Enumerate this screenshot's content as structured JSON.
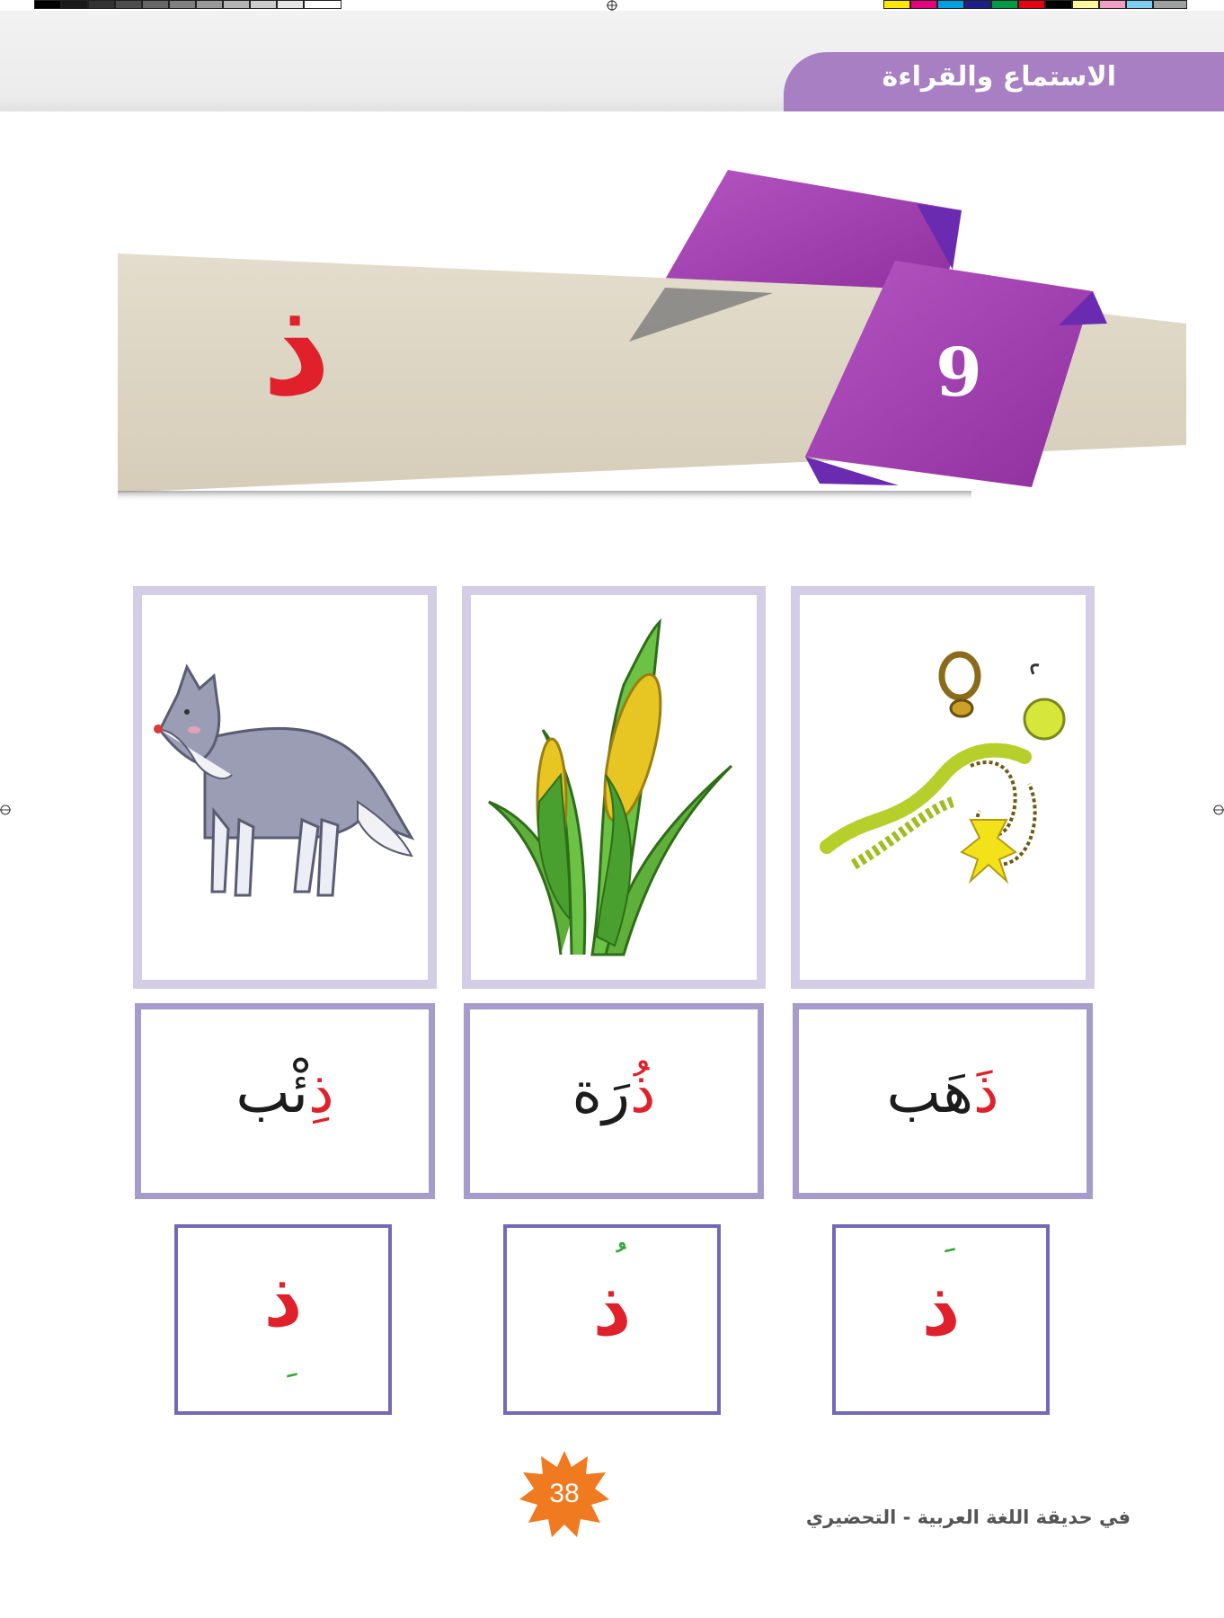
{
  "header": {
    "title": "الاستماع والقراءة"
  },
  "banner": {
    "letter": "ذ",
    "lesson_number": "9"
  },
  "cards": [
    {
      "image": "gold-jewelry",
      "word_first": "ذَ",
      "word_rest": "هَب",
      "letter": "ذ",
      "vowel_mark": "َ",
      "vowel_position": "above"
    },
    {
      "image": "corn",
      "word_first": "ذُ",
      "word_rest": "رَة",
      "letter": "ذ",
      "vowel_mark": "ُ",
      "vowel_position": "above"
    },
    {
      "image": "wolf",
      "word_first": "ذِ",
      "word_rest": "ئْب",
      "letter": "ذ",
      "vowel_mark": "ِ",
      "vowel_position": "below"
    }
  ],
  "colors": {
    "accent_purple": "#a77fc2",
    "ribbon_purple": "#9b3aa8",
    "letter_red": "#e0202a",
    "vowel_green": "#35a83a",
    "banner_beige": "#ddd5c4",
    "page_badge_orange": "#f07a1f"
  },
  "footer": {
    "page_number": "38",
    "book_title": "في حديقة اللغة العربية - التحضيري"
  }
}
